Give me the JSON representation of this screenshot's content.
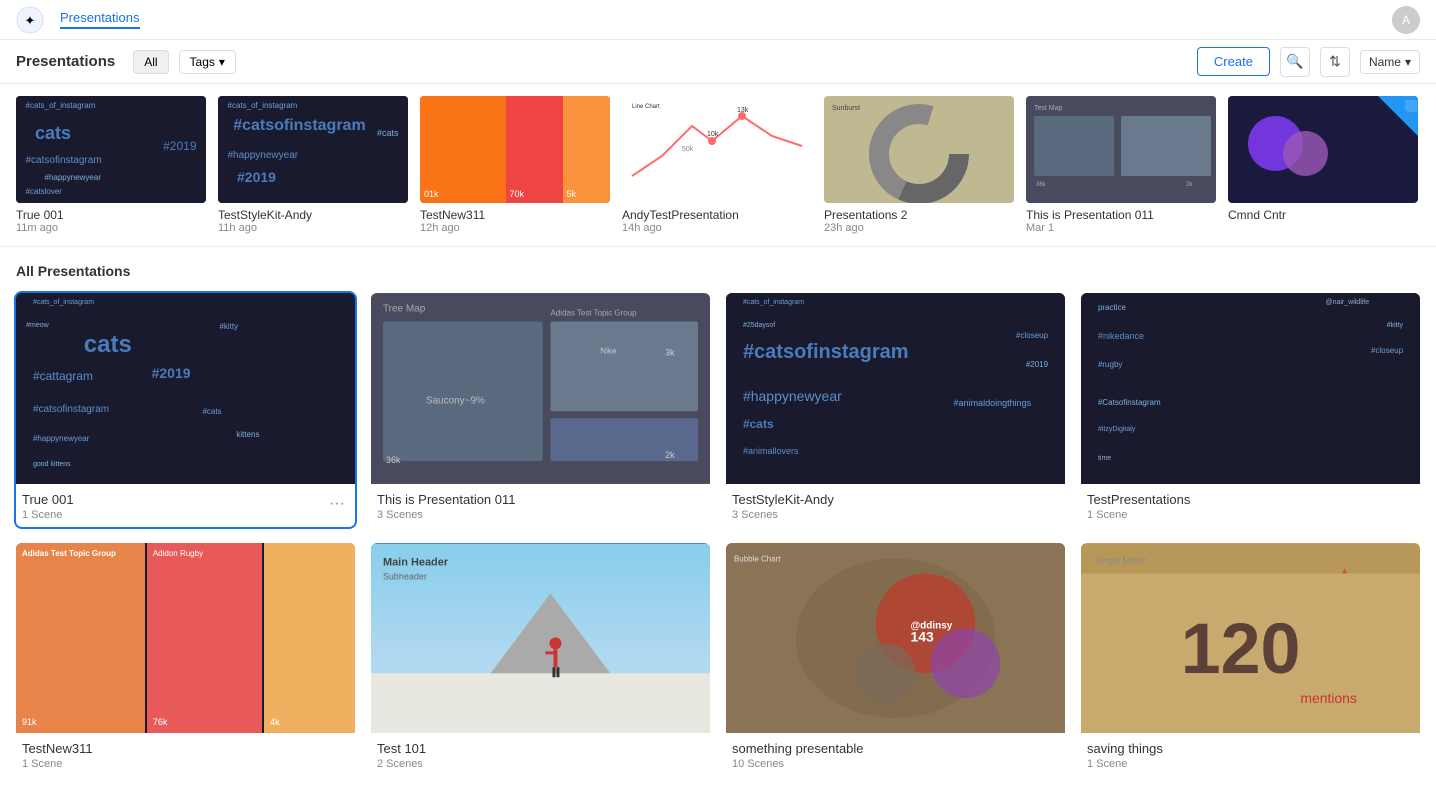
{
  "nav": {
    "tab": "Presentations",
    "avatar_initials": "A"
  },
  "toolbar": {
    "title": "Presentations",
    "all_label": "All",
    "tags_label": "Tags",
    "create_label": "Create",
    "sort_label": "Name"
  },
  "recent": [
    {
      "id": "r1",
      "name": "True 001",
      "time": "11m ago",
      "thumb_type": "wordcloud"
    },
    {
      "id": "r2",
      "name": "TestStyleKit-Andy",
      "time": "11h ago",
      "thumb_type": "wordcloud"
    },
    {
      "id": "r3",
      "name": "TestNew311",
      "time": "12h ago",
      "thumb_type": "orange_treemap"
    },
    {
      "id": "r4",
      "name": "AndyTestPresentation",
      "time": "14h ago",
      "thumb_type": "linechart"
    },
    {
      "id": "r5",
      "name": "Presentations 2",
      "time": "23h ago",
      "thumb_type": "sunburst"
    },
    {
      "id": "r6",
      "name": "This is Presentation 011",
      "time": "Mar 1",
      "thumb_type": "testmap"
    },
    {
      "id": "r7",
      "name": "Cmnd Cntr",
      "time": "",
      "thumb_type": "purple_circles"
    }
  ],
  "section_title": "All Presentations",
  "presentations": [
    {
      "id": "p1",
      "name": "True 001",
      "scenes": "1 Scene",
      "thumb_type": "wordcloud",
      "selected": true
    },
    {
      "id": "p2",
      "name": "This is Presentation 011",
      "scenes": "3 Scenes",
      "thumb_type": "treemap_gray"
    },
    {
      "id": "p3",
      "name": "TestStyleKit-Andy",
      "scenes": "3 Scenes",
      "thumb_type": "wordcloud2"
    },
    {
      "id": "p4",
      "name": "TestPresentations",
      "scenes": "1 Scene",
      "thumb_type": "wordcloud3"
    },
    {
      "id": "p5",
      "name": "TestNew311",
      "scenes": "1 Scene",
      "thumb_type": "orange_treemap2"
    },
    {
      "id": "p6",
      "name": "Test 101",
      "scenes": "2 Scenes",
      "thumb_type": "mountain"
    },
    {
      "id": "p7",
      "name": "something presentable",
      "scenes": "10 Scenes",
      "thumb_type": "squirrel"
    },
    {
      "id": "p8",
      "name": "saving things",
      "scenes": "1 Scene",
      "thumb_type": "single_metric"
    }
  ],
  "more_btn_label": "•••",
  "icons": {
    "search": "🔍",
    "sort": "⇅",
    "chevron": "▾",
    "logo": "✦"
  }
}
